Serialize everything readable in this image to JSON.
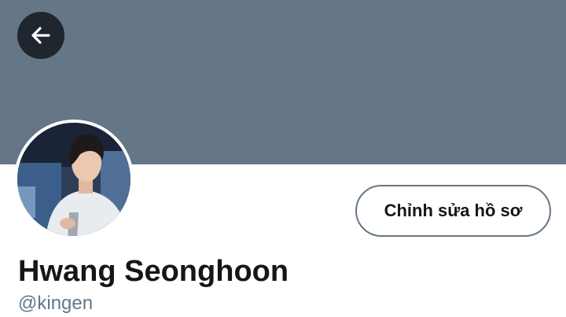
{
  "profile": {
    "display_name": "Hwang Seonghoon",
    "handle": "@kingen",
    "edit_button_label": "Chỉnh sửa hồ sơ",
    "back_icon": "arrow-left-icon"
  },
  "colors": {
    "banner": "#657786",
    "back_button_bg": "#1f262d",
    "text_primary": "#14171a",
    "text_secondary": "#657786",
    "button_border": "#657786"
  }
}
